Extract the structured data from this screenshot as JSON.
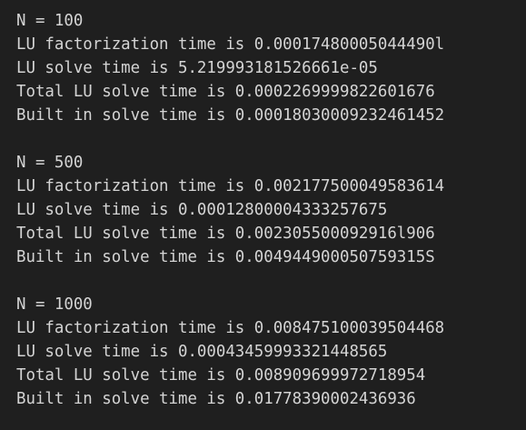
{
  "terminal": {
    "blocks": [
      {
        "header": "N = 100",
        "lines": [
          "LU factorization time is 0.00017480005044490l",
          "LU solve time is 5.219993181526661e-05",
          "Total LU solve time is 0.0002269999822601676",
          "Built in solve time is 0.00018030009232461452"
        ]
      },
      {
        "header": "N = 500",
        "lines": [
          "LU factorization time is 0.002177500049583614",
          "LU solve time is 0.00012800004333257675",
          "Total LU solve time is 0.002305500092916l906",
          "Built in solve time is 0.004944900050759315S"
        ]
      },
      {
        "header": "N = 1000",
        "lines": [
          "LU factorization time is 0.008475100039504468",
          "LU solve time is 0.00043459993321448565",
          "Total LU solve time is 0.008909699972718954",
          "Built in solve time is 0.01778390002436936"
        ]
      }
    ]
  }
}
